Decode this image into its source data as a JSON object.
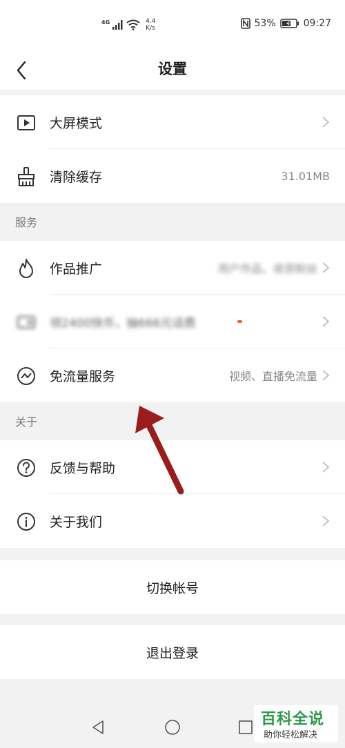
{
  "status_bar": {
    "network": "4G",
    "speed_value": "4.4",
    "speed_unit": "K/s",
    "battery": "53%",
    "time": "09:27"
  },
  "header": {
    "title": "设置"
  },
  "settings_top": [
    {
      "label": "大屏模式",
      "icon": "play-screen-icon"
    },
    {
      "label": "清除缓存",
      "value": "31.01MB",
      "icon": "broom-icon"
    }
  ],
  "sections": {
    "service": "服务",
    "about": "关于"
  },
  "service_items": [
    {
      "label": "作品推广",
      "value": "用户作品、收获粉丝",
      "icon": "flame-icon"
    },
    {
      "label": "领2400快币，抽666元话费",
      "icon": "card-icon"
    },
    {
      "label": "免流量服务",
      "value": "视频、直播免流量",
      "icon": "trend-icon"
    }
  ],
  "about_items": [
    {
      "label": "反馈与帮助",
      "icon": "question-icon"
    },
    {
      "label": "关于我们",
      "icon": "info-icon"
    }
  ],
  "actions": {
    "switch_account": "切换帐号",
    "logout": "退出登录"
  },
  "watermark": {
    "title": "百科全说",
    "subtitle": "助你轻松解决"
  }
}
